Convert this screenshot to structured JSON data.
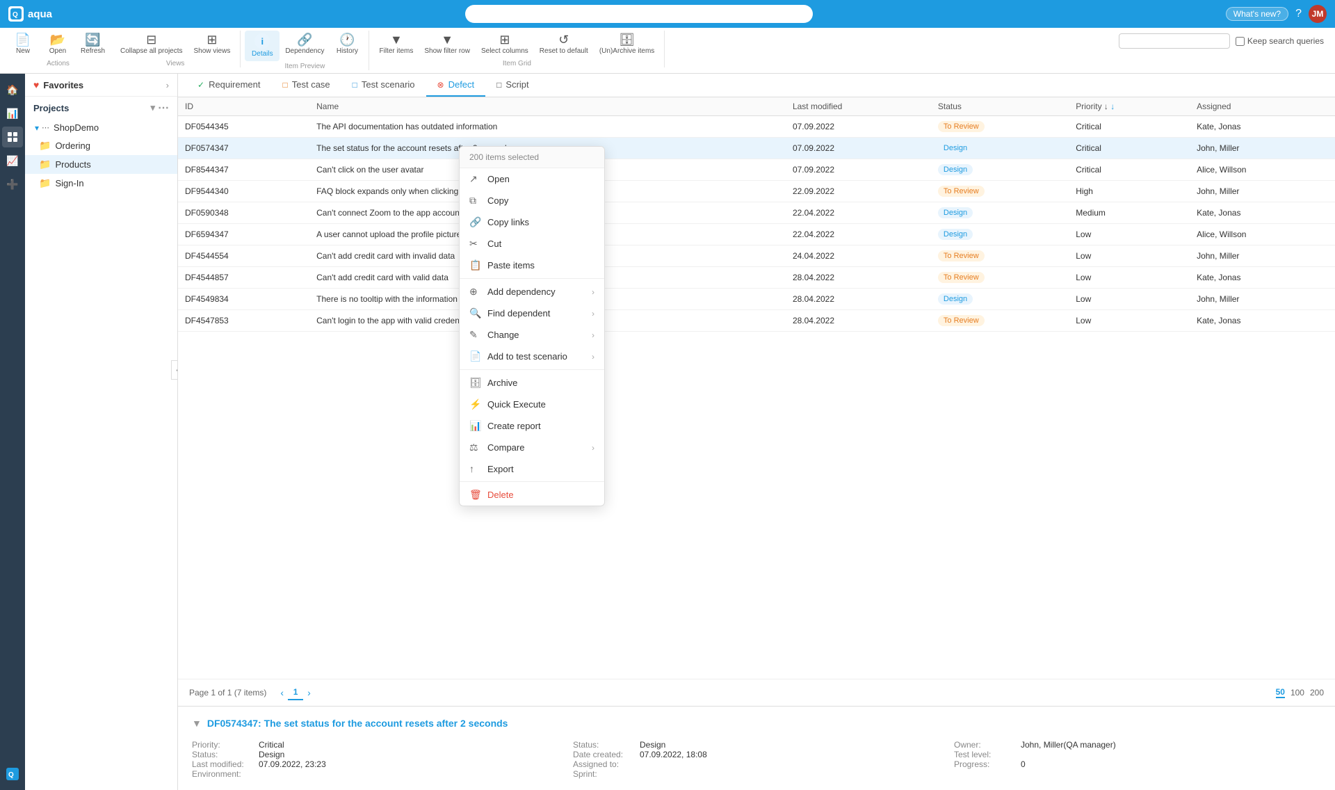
{
  "app": {
    "name": "aqua",
    "logo_text": "Q",
    "search_placeholder": "",
    "whats_new_label": "What's new?",
    "help_icon": "?",
    "avatar_initials": "JM"
  },
  "toolbar": {
    "sections": {
      "actions": {
        "label": "Actions",
        "buttons": [
          {
            "id": "new",
            "label": "New",
            "icon": "📄",
            "has_arrow": true
          },
          {
            "id": "open",
            "label": "Open",
            "icon": "📂"
          },
          {
            "id": "refresh",
            "label": "Refresh",
            "icon": "🔄",
            "has_arrow": true
          }
        ]
      },
      "views": {
        "label": "Views",
        "buttons": [
          {
            "id": "collapse",
            "label": "Collapse all projects",
            "icon": "⊟"
          },
          {
            "id": "show-views",
            "label": "Show views",
            "icon": "⊞"
          }
        ]
      },
      "item_preview": {
        "label": "Item Preview",
        "buttons": [
          {
            "id": "details",
            "label": "Details",
            "icon": "ℹ",
            "active": true
          },
          {
            "id": "dependency",
            "label": "Dependency",
            "icon": "🔗"
          },
          {
            "id": "history",
            "label": "History",
            "icon": "🕐"
          }
        ]
      },
      "item_grid": {
        "label": "Item Grid",
        "buttons": [
          {
            "id": "filter-items",
            "label": "Filter items",
            "icon": "▼"
          },
          {
            "id": "show-filter-row",
            "label": "Show filter row",
            "icon": "▼"
          },
          {
            "id": "select-columns",
            "label": "Select columns",
            "icon": "⊞"
          },
          {
            "id": "reset-to-default",
            "label": "Reset to default",
            "icon": "↺"
          },
          {
            "id": "unarchive",
            "label": "(Un)Archive items",
            "icon": "🗄"
          }
        ]
      }
    },
    "search_small_placeholder": "",
    "keep_search_label": "Keep search queries"
  },
  "sidebar": {
    "favorites_label": "Favorites",
    "nav_icons": [
      "🏠",
      "📊",
      "🔧",
      "📈",
      "➕"
    ],
    "bottom_icon": "Q"
  },
  "nav": {
    "projects_label": "Projects",
    "tree": [
      {
        "id": "shopDemo",
        "label": "ShopDemo",
        "expanded": true,
        "children": [
          {
            "id": "ordering",
            "label": "Ordering",
            "type": "folder",
            "color": "orange"
          },
          {
            "id": "products",
            "label": "Products",
            "type": "folder",
            "color": "blue",
            "active": true
          },
          {
            "id": "sign-in",
            "label": "Sign-In",
            "type": "folder",
            "color": "yellow"
          }
        ]
      }
    ]
  },
  "tabs": [
    {
      "id": "requirement",
      "label": "Requirement",
      "icon": "✓",
      "icon_color": "green",
      "active": false
    },
    {
      "id": "test-case",
      "label": "Test case",
      "icon": "□",
      "icon_color": "orange",
      "active": false
    },
    {
      "id": "test-scenario",
      "label": "Test scenario",
      "icon": "□",
      "icon_color": "blue",
      "active": false
    },
    {
      "id": "defect",
      "label": "Defect",
      "icon": "⊗",
      "icon_color": "red",
      "active": true
    },
    {
      "id": "script",
      "label": "Script",
      "icon": "□",
      "icon_color": "gray",
      "active": false
    }
  ],
  "table": {
    "columns": [
      {
        "id": "id",
        "label": "ID"
      },
      {
        "id": "name",
        "label": "Name"
      },
      {
        "id": "last_modified",
        "label": "Last modified"
      },
      {
        "id": "status",
        "label": "Status"
      },
      {
        "id": "priority",
        "label": "Priority ↓",
        "sort_active": true
      },
      {
        "id": "assigned",
        "label": "Assigned"
      }
    ],
    "rows": [
      {
        "id": "DF0544345",
        "name": "The API documentation has outdated information",
        "last_modified": "07.09.2022",
        "status": "To Review",
        "priority": "Critical",
        "assigned": "Kate, Jonas",
        "selected": false
      },
      {
        "id": "DF0574347",
        "name": "The set status for the account resets after 2 seconds",
        "last_modified": "07.09.2022",
        "status": "Design",
        "priority": "Critical",
        "assigned": "John, Miller",
        "selected": true
      },
      {
        "id": "DF8544347",
        "name": "Can't click on the user avatar",
        "last_modified": "07.09.2022",
        "status": "Design",
        "priority": "Critical",
        "assigned": "Alice, Willson",
        "selected": false
      },
      {
        "id": "DF9544340",
        "name": "FAQ block expands only when clicking twice",
        "last_modified": "22.09.2022",
        "status": "To Review",
        "priority": "High",
        "assigned": "John, Miller",
        "selected": false
      },
      {
        "id": "DF0590348",
        "name": "Can't connect Zoom to the app account",
        "last_modified": "22.04.2022",
        "status": "Design",
        "priority": "Medium",
        "assigned": "Kate, Jonas",
        "selected": false
      },
      {
        "id": "DF6594347",
        "name": "A user cannot upload the profile picture",
        "last_modified": "22.04.2022",
        "status": "Design",
        "priority": "Low",
        "assigned": "Alice, Willson",
        "selected": false
      },
      {
        "id": "DF4544554",
        "name": "Can't add credit card with invalid data",
        "last_modified": "24.04.2022",
        "status": "To Review",
        "priority": "Low",
        "assigned": "John, Miller",
        "selected": false
      },
      {
        "id": "DF4544857",
        "name": "Can't add credit card with valid data",
        "last_modified": "28.04.2022",
        "status": "To Review",
        "priority": "Low",
        "assigned": "Kate, Jonas",
        "selected": false
      },
      {
        "id": "DF4549834",
        "name": "There is no tooltip with the information",
        "last_modified": "28.04.2022",
        "status": "Design",
        "priority": "Low",
        "assigned": "John, Miller",
        "selected": false
      },
      {
        "id": "DF4547853",
        "name": "Can't login to the app with valid credentials",
        "last_modified": "28.04.2022",
        "status": "To Review",
        "priority": "Low",
        "assigned": "Kate, Jonas",
        "selected": false
      }
    ],
    "footer": {
      "page_info": "Page 1 of 1 (7 items)",
      "current_page": "1",
      "per_page_options": [
        "50",
        "100",
        "200"
      ],
      "active_per_page": "50"
    }
  },
  "context_menu": {
    "header": "200 items selected",
    "items": [
      {
        "id": "open",
        "label": "Open",
        "icon": "↗",
        "has_arrow": false
      },
      {
        "id": "copy",
        "label": "Copy",
        "icon": "⧉",
        "has_arrow": false
      },
      {
        "id": "copy-links",
        "label": "Copy links",
        "icon": "🔗",
        "has_arrow": false
      },
      {
        "id": "cut",
        "label": "Cut",
        "icon": "✂",
        "has_arrow": false
      },
      {
        "id": "paste-items",
        "label": "Paste items",
        "icon": "📋",
        "has_arrow": false
      },
      {
        "id": "add-dependency",
        "label": "Add dependency",
        "icon": "⊕",
        "has_arrow": true
      },
      {
        "id": "find-dependent",
        "label": "Find  dependent",
        "icon": "🔍",
        "has_arrow": true
      },
      {
        "id": "change",
        "label": "Change",
        "icon": "✎",
        "has_arrow": true
      },
      {
        "id": "add-to-test-scenario",
        "label": "Add to test scenario",
        "icon": "📄",
        "has_arrow": true
      },
      {
        "id": "archive",
        "label": "Archive",
        "icon": "🗄",
        "has_arrow": false
      },
      {
        "id": "quick-execute",
        "label": "Quick Execute",
        "icon": "⚡",
        "has_arrow": false
      },
      {
        "id": "create-report",
        "label": "Create report",
        "icon": "📊",
        "has_arrow": false
      },
      {
        "id": "compare",
        "label": "Compare",
        "icon": "⚖",
        "has_arrow": true
      },
      {
        "id": "export",
        "label": "Export",
        "icon": "↑",
        "has_arrow": false
      },
      {
        "id": "delete",
        "label": "Delete",
        "icon": "🗑",
        "has_arrow": false,
        "danger": true
      }
    ]
  },
  "detail_panel": {
    "title": "DF0574347: The set status for the account resets after 2 seconds",
    "toggle_icon": "▼",
    "fields": [
      {
        "label": "Priority:",
        "value": "Critical"
      },
      {
        "label": "Status:",
        "value": "Design"
      },
      {
        "label": "Last modified:",
        "value": "07.09.2022, 23:23"
      },
      {
        "label": "Environment:",
        "value": ""
      }
    ],
    "fields_col2": [
      {
        "label": "Status:",
        "value": "Design"
      },
      {
        "label": "Date created:",
        "value": "07.09.2022, 18:08"
      },
      {
        "label": "Assigned to:",
        "value": ""
      },
      {
        "label": "Sprint:",
        "value": ""
      }
    ],
    "fields_col3": [
      {
        "label": "Owner:",
        "value": "John, Miller(QA manager)"
      },
      {
        "label": "Test level:",
        "value": ""
      },
      {
        "label": "Progress:",
        "value": "0"
      }
    ]
  }
}
